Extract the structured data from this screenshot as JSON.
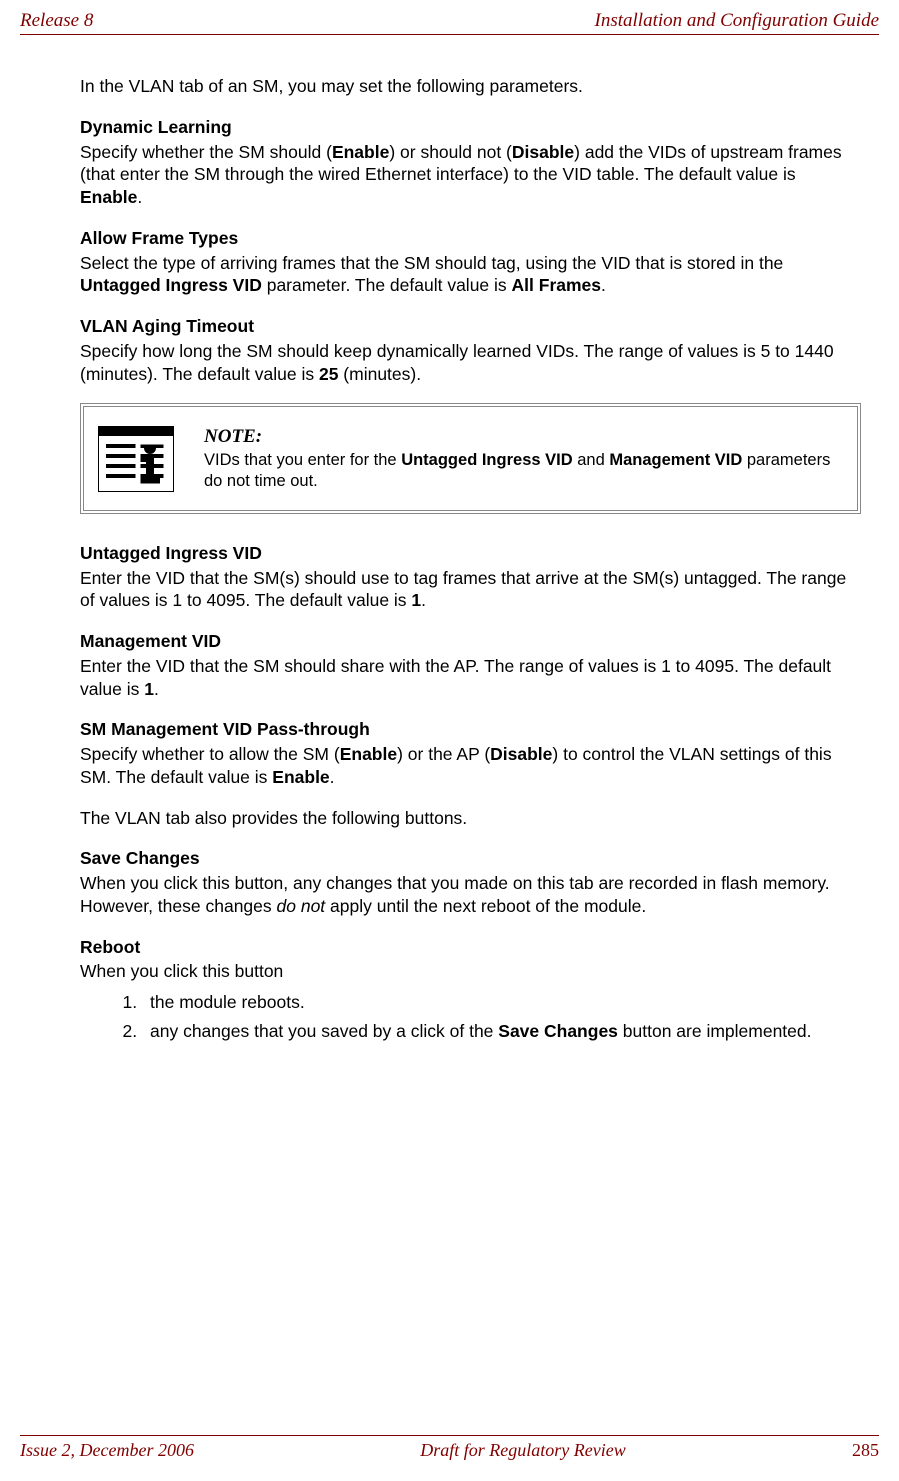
{
  "header": {
    "left": "Release 8",
    "right": "Installation and Configuration Guide"
  },
  "intro": "In the VLAN tab of an SM, you may set the following parameters.",
  "s1": {
    "title": "Dynamic Learning",
    "t1": "Specify whether the SM should (",
    "b1": "Enable",
    "t2": ") or should not (",
    "b2": "Disable",
    "t3": ") add the VIDs of upstream frames (that enter the SM through the wired Ethernet interface) to the VID table. The default value is ",
    "b3": "Enable",
    "t4": "."
  },
  "s2": {
    "title": "Allow Frame Types",
    "t1": "Select the type of arriving frames that the SM should tag, using the VID that is stored in the ",
    "b1": "Untagged Ingress VID",
    "t2": " parameter. The default value is ",
    "b2": "All Frames",
    "t3": "."
  },
  "s3": {
    "title": "VLAN Aging Timeout",
    "t1": "Specify how long the SM should keep dynamically learned VIDs. The range of values is 5 to 1440 (minutes). The default value is ",
    "b1": "25",
    "t2": " (minutes)."
  },
  "note": {
    "label": "NOTE:",
    "t1": "VIDs that you enter for the ",
    "b1": "Untagged Ingress VID",
    "t2": " and ",
    "b2": "Management VID",
    "t3": " parameters do not time out."
  },
  "s4": {
    "title": "Untagged Ingress VID",
    "t1": "Enter the VID that the SM(s) should use to tag frames that arrive at the SM(s) untagged. The range of values is 1 to 4095. The default value is ",
    "b1": "1",
    "t2": "."
  },
  "s5": {
    "title": "Management VID",
    "t1": "Enter the VID that the SM should share with the AP. The range of values is 1 to 4095. The default value is ",
    "b1": "1",
    "t2": "."
  },
  "s6": {
    "title": "SM Management VID Pass-through",
    "t1": "Specify whether to allow the SM (",
    "b1": "Enable",
    "t2": ") or the AP (",
    "b2": "Disable",
    "t3": ") to control the VLAN settings of this SM. The default value is ",
    "b3": "Enable",
    "t4": "."
  },
  "mid": "The VLAN tab also provides the following buttons.",
  "s7": {
    "title": "Save Changes",
    "t1": "When you click this button, any changes that you made on this tab are recorded in flash memory. However, these changes ",
    "i1": "do not",
    "t2": " apply until the next reboot of the module."
  },
  "s8": {
    "title": "Reboot",
    "t1": "When you click this button",
    "li1": "the module reboots.",
    "li2a": "any changes that you saved by a click of the ",
    "li2b": "Save Changes",
    "li2c": " button are implemented."
  },
  "footer": {
    "left": "Issue 2, December 2006",
    "center": "Draft for Regulatory Review",
    "right": "285"
  }
}
